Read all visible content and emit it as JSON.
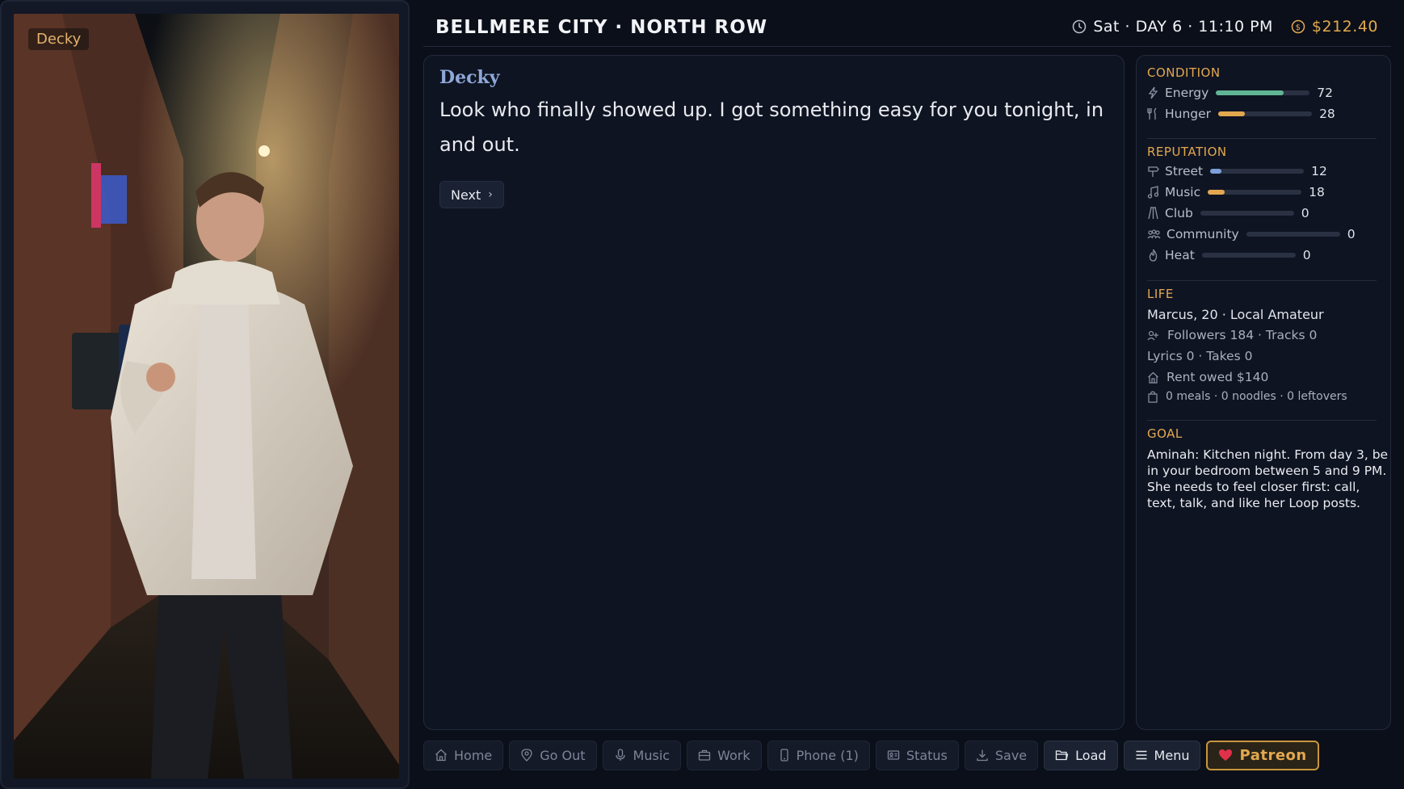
{
  "portrait": {
    "name_tag": "Decky"
  },
  "header": {
    "location": "BELLMERE CITY · NORTH ROW",
    "time": "Sat · DAY 6 · 11:10 PM",
    "money": "$212.40"
  },
  "dialogue": {
    "speaker": "Decky",
    "text": "Look who finally showed up. I got something easy for you tonight, in and out.",
    "next_label": "Next"
  },
  "stats": {
    "condition_title": "CONDITION",
    "condition": [
      {
        "label": "Energy",
        "value": 72,
        "color": "#5fb594",
        "icon": "bolt-icon"
      },
      {
        "label": "Hunger",
        "value": 28,
        "color": "#e3a84f",
        "icon": "utensils-icon"
      }
    ],
    "reputation_title": "REPUTATION",
    "reputation": [
      {
        "label": "Street",
        "value": 12,
        "color": "#7d9fd8",
        "icon": "street-sign-icon"
      },
      {
        "label": "Music",
        "value": 18,
        "color": "#e3a84f",
        "icon": "music-note-icon"
      },
      {
        "label": "Club",
        "value": 0,
        "color": "#7d9fd8",
        "icon": "club-icon"
      },
      {
        "label": "Community",
        "value": 0,
        "color": "#7d9fd8",
        "icon": "community-icon"
      },
      {
        "label": "Heat",
        "value": 0,
        "color": "#d86f5f",
        "icon": "flame-icon"
      }
    ],
    "life_title": "LIFE",
    "life": {
      "identity": "Marcus, 20 · Local Amateur",
      "followers": "Followers 184 · Tracks 0",
      "lyrics": "Lyrics 0 · Takes 0",
      "rent": "Rent owed $140",
      "food": "0 meals · 0 noodles · 0 leftovers"
    },
    "goal_title": "GOAL",
    "goal": "Aminah: Kitchen night. From day 3, be in your bedroom between 5 and 9 PM. She needs to feel closer first: call, text, talk, and like her Loop posts."
  },
  "nav": [
    {
      "label": "Home",
      "icon": "home-icon",
      "state": "dim"
    },
    {
      "label": "Go Out",
      "icon": "map-pin-icon",
      "state": "dim"
    },
    {
      "label": "Music",
      "icon": "microphone-icon",
      "state": "dim"
    },
    {
      "label": "Work",
      "icon": "briefcase-icon",
      "state": "dim"
    },
    {
      "label": "Phone (1)",
      "icon": "phone-icon",
      "state": "dim"
    },
    {
      "label": "Status",
      "icon": "id-card-icon",
      "state": "dim"
    },
    {
      "label": "Save",
      "icon": "download-icon",
      "state": "dim"
    },
    {
      "label": "Load",
      "icon": "folder-open-icon",
      "state": "active"
    },
    {
      "label": "Menu",
      "icon": "menu-icon",
      "state": "active"
    },
    {
      "label": "Patreon",
      "icon": "heart-icon",
      "state": "patreon"
    }
  ]
}
